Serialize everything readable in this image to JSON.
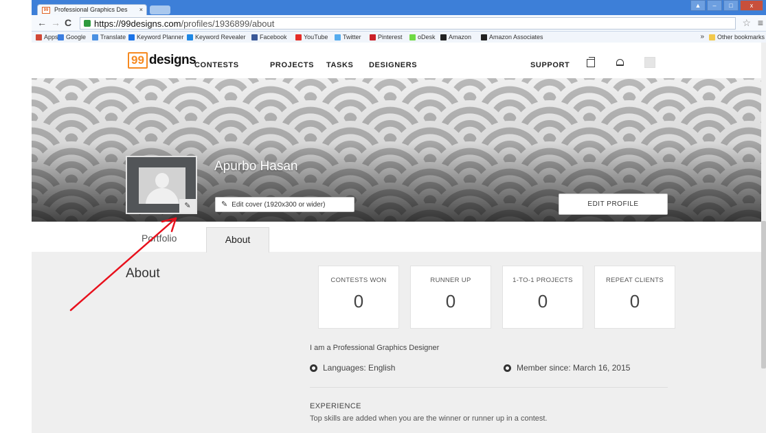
{
  "browser": {
    "tab_title": "Professional Graphics Des",
    "tab_favicon": "99",
    "tab_close": "×",
    "window_buttons": [
      "▲",
      "–",
      "□",
      "x"
    ],
    "url_host": "https://99designs.com",
    "url_path": "/profiles/1936899/about",
    "bookmarks": [
      {
        "label": "Apps",
        "icon": "apps-grid-icon",
        "color": "#d14836"
      },
      {
        "label": "Google",
        "icon": "google-icon",
        "color": "#3b7de0"
      },
      {
        "label": "Translate",
        "icon": "translate-icon",
        "color": "#4a90e2"
      },
      {
        "label": "Keyword Planner",
        "icon": "keyword-planner-icon",
        "color": "#1a73e8"
      },
      {
        "label": "Keyword Revealer",
        "icon": "keyword-revealer-icon",
        "color": "#1e88e5"
      },
      {
        "label": "Facebook",
        "icon": "facebook-icon",
        "color": "#3b5998"
      },
      {
        "label": "YouTube",
        "icon": "youtube-icon",
        "color": "#e52d27"
      },
      {
        "label": "Twitter",
        "icon": "twitter-icon",
        "color": "#55acee"
      },
      {
        "label": "Pinterest",
        "icon": "pinterest-icon",
        "color": "#cb2027"
      },
      {
        "label": "oDesk",
        "icon": "odesk-icon",
        "color": "#6fda44"
      },
      {
        "label": "Amazon",
        "icon": "amazon-icon",
        "color": "#222222"
      },
      {
        "label": "Amazon Associates",
        "icon": "amazon-associates-icon",
        "color": "#222222"
      }
    ],
    "bookmarks_more": "»",
    "other_bookmarks": "Other bookmarks"
  },
  "site": {
    "logo_box": "99",
    "logo_text": "designs",
    "nav": {
      "contests": "CONTESTS",
      "projects": "PROJECTS",
      "tasks": "TASKS",
      "designers": "DESIGNERS",
      "support": "SUPPORT"
    },
    "accent_color": "#f6891f"
  },
  "profile": {
    "name": "Apurbo Hasan",
    "edit_cover_label": "Edit cover (1920x300 or wider)",
    "edit_profile_label": "EDIT PROFILE",
    "tabs": [
      {
        "label": "Portfolio",
        "active": false
      },
      {
        "label": "About",
        "active": true
      }
    ]
  },
  "about": {
    "heading": "About",
    "stats": [
      {
        "label": "CONTESTS WON",
        "value": "0"
      },
      {
        "label": "RUNNER UP",
        "value": "0"
      },
      {
        "label": "1-TO-1 PROJECTS",
        "value": "0"
      },
      {
        "label": "REPEAT CLIENTS",
        "value": "0"
      }
    ],
    "bio": "I am a Professional Graphics Designer",
    "languages": "Languages: English",
    "member_since": "Member since: March 16, 2015",
    "experience_heading": "EXPERIENCE",
    "experience_text": "Top skills are added when you are the winner or runner up in a contest."
  },
  "annotation": {
    "arrow_color": "#e8101c"
  }
}
